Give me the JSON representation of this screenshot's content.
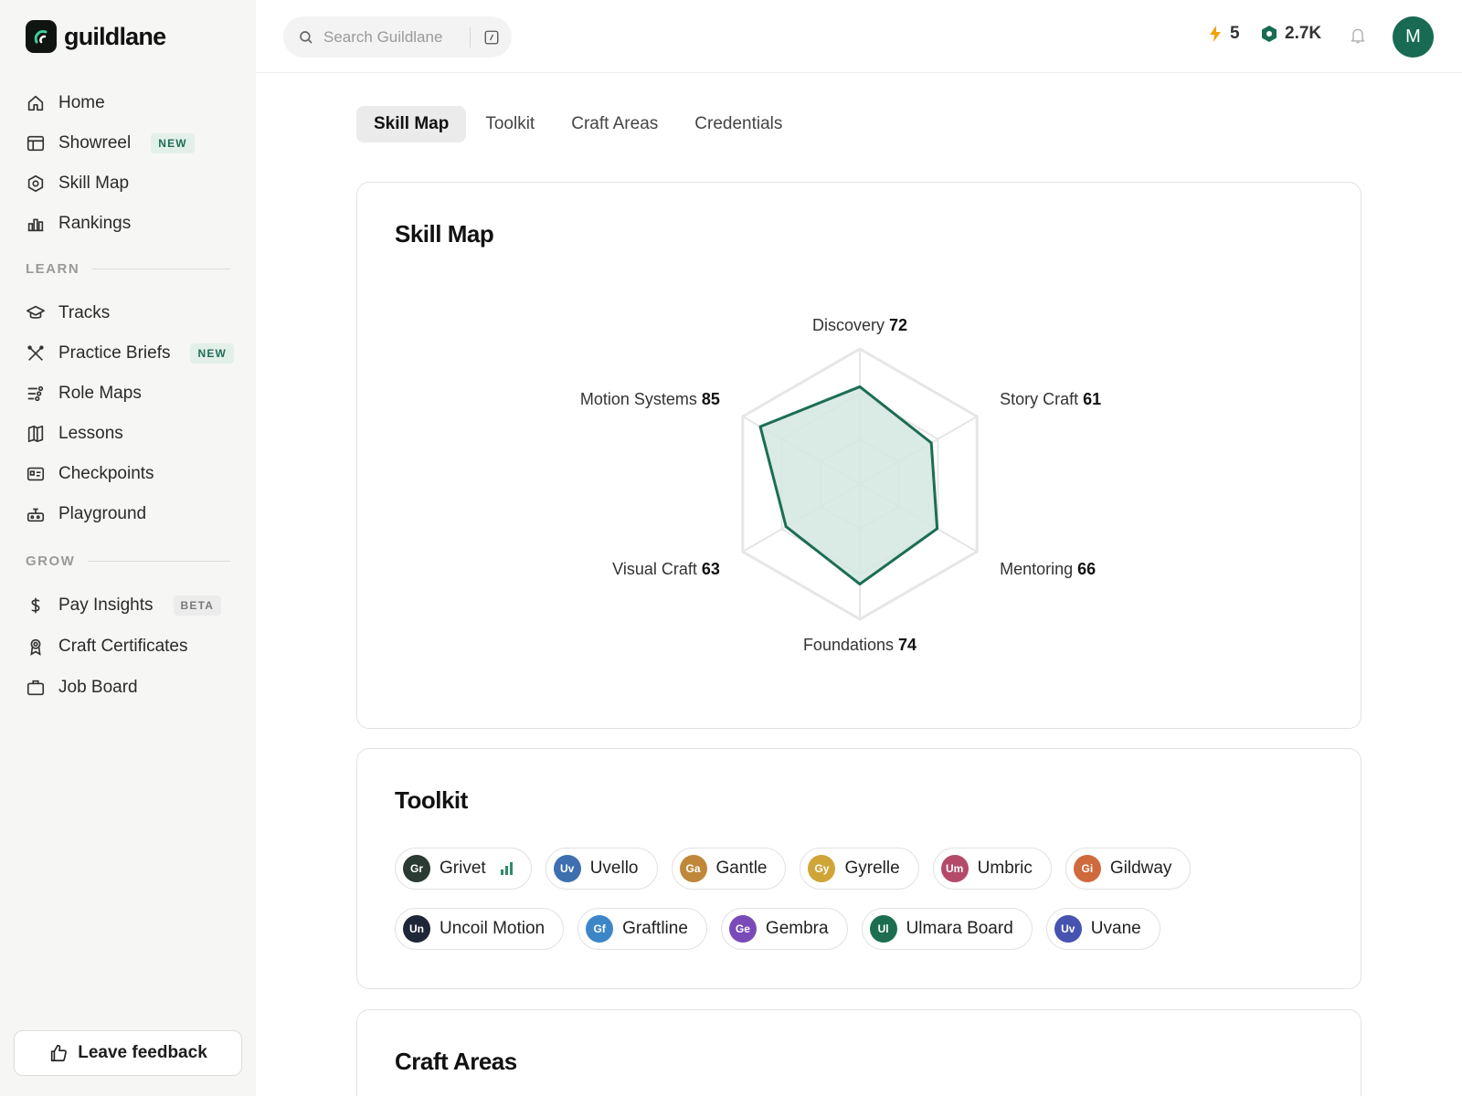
{
  "app": {
    "name": "guildlane"
  },
  "sidebar": {
    "items": [
      {
        "label": "Home",
        "badge": ""
      },
      {
        "label": "Showreel",
        "badge": "NEW"
      },
      {
        "label": "Skill Map",
        "badge": ""
      },
      {
        "label": "Rankings",
        "badge": ""
      }
    ],
    "learn_heading": "LEARN",
    "learn_items": [
      {
        "label": "Tracks",
        "badge": ""
      },
      {
        "label": "Practice Briefs",
        "badge": "NEW"
      },
      {
        "label": "Role Maps",
        "badge": ""
      },
      {
        "label": "Lessons",
        "badge": ""
      },
      {
        "label": "Checkpoints",
        "badge": ""
      },
      {
        "label": "Playground",
        "badge": ""
      }
    ],
    "grow_heading": "GROW",
    "grow_items": [
      {
        "label": "Pay Insights",
        "badge": "BETA"
      },
      {
        "label": "Craft Certificates",
        "badge": ""
      },
      {
        "label": "Job Board",
        "badge": ""
      }
    ],
    "feedback_label": "Leave feedback"
  },
  "header": {
    "search_placeholder": "Search Guildlane",
    "streak": "5",
    "points": "2.7K",
    "avatar_initial": "M"
  },
  "tabs": [
    "Skill Map",
    "Toolkit",
    "Craft Areas",
    "Credentials"
  ],
  "skill_map": {
    "title": "Skill Map",
    "axes": [
      {
        "label": "Discovery",
        "value": 72
      },
      {
        "label": "Story Craft",
        "value": 61
      },
      {
        "label": "Mentoring",
        "value": 66
      },
      {
        "label": "Foundations",
        "value": 74
      },
      {
        "label": "Visual Craft",
        "value": 63
      },
      {
        "label": "Motion Systems",
        "value": 85
      }
    ]
  },
  "chart_data": {
    "type": "radar",
    "title": "Skill Map",
    "categories": [
      "Discovery",
      "Story Craft",
      "Mentoring",
      "Foundations",
      "Visual Craft",
      "Motion Systems"
    ],
    "values": [
      72,
      61,
      66,
      74,
      63,
      85
    ],
    "ylim": [
      0,
      100
    ],
    "rings": 3,
    "grid": true
  },
  "toolkit": {
    "title": "Toolkit",
    "tools": [
      {
        "abbr": "Gr",
        "name": "Grivet",
        "color": "#2c3a34",
        "bars": true
      },
      {
        "abbr": "Uv",
        "name": "Uvello",
        "color": "#3e6fb0",
        "bars": false
      },
      {
        "abbr": "Ga",
        "name": "Gantle",
        "color": "#c0873a",
        "bars": false
      },
      {
        "abbr": "Gy",
        "name": "Gyrelle",
        "color": "#cfa538",
        "bars": false
      },
      {
        "abbr": "Um",
        "name": "Umbric",
        "color": "#b44a6a",
        "bars": false
      },
      {
        "abbr": "Gi",
        "name": "Gildway",
        "color": "#cf6a3c",
        "bars": false
      },
      {
        "abbr": "Un",
        "name": "Uncoil Motion",
        "color": "#1f2637",
        "bars": false
      },
      {
        "abbr": "Gf",
        "name": "Graftline",
        "color": "#3c86c8",
        "bars": false
      },
      {
        "abbr": "Ge",
        "name": "Gembra",
        "color": "#7a4bb8",
        "bars": false
      },
      {
        "abbr": "Ul",
        "name": "Ulmara Board",
        "color": "#1d6e50",
        "bars": false
      },
      {
        "abbr": "Uv",
        "name": "Uvane",
        "color": "#4753b0",
        "bars": false
      }
    ]
  },
  "craft_areas": {
    "title": "Craft Areas"
  },
  "colors": {
    "accent": "#186b52",
    "radar_stroke": "#1c6d55",
    "radar_fill": "#d4e6e0",
    "badge_text": "#1f6e57",
    "streak_icon": "#f2a20e"
  }
}
